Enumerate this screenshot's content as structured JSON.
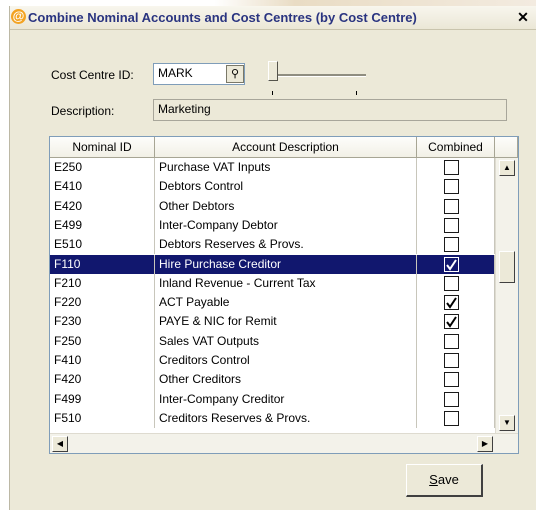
{
  "window": {
    "title": "Combine Nominal Accounts and Cost Centres (by Cost Centre)",
    "icon": "@",
    "close_label": "✕"
  },
  "form": {
    "cost_centre_label": "Cost Centre ID:",
    "cost_centre_value": "MARK",
    "lookup_icon": "magnifier-icon",
    "lookup_glyph": "⚲",
    "description_label": "Description:",
    "description_value": "Marketing"
  },
  "grid": {
    "columns": [
      "Nominal ID",
      "Account Description",
      "Combined"
    ],
    "rows": [
      {
        "id": "E250",
        "desc": "Purchase VAT Inputs",
        "combined": false,
        "selected": false
      },
      {
        "id": "E410",
        "desc": "Debtors Control",
        "combined": false,
        "selected": false
      },
      {
        "id": "E420",
        "desc": "Other Debtors",
        "combined": false,
        "selected": false
      },
      {
        "id": "E499",
        "desc": "Inter-Company Debtor",
        "combined": false,
        "selected": false
      },
      {
        "id": "E510",
        "desc": "Debtors Reserves & Provs.",
        "combined": false,
        "selected": false
      },
      {
        "id": "F110",
        "desc": "Hire Purchase Creditor",
        "combined": true,
        "selected": true
      },
      {
        "id": "F210",
        "desc": "Inland Revenue - Current Tax",
        "combined": false,
        "selected": false
      },
      {
        "id": "F220",
        "desc": "ACT Payable",
        "combined": true,
        "selected": false
      },
      {
        "id": "F230",
        "desc": "PAYE & NIC for Remit",
        "combined": true,
        "selected": false
      },
      {
        "id": "F250",
        "desc": "Sales VAT Outputs",
        "combined": false,
        "selected": false
      },
      {
        "id": "F410",
        "desc": "Creditors Control",
        "combined": false,
        "selected": false
      },
      {
        "id": "F420",
        "desc": "Other Creditors",
        "combined": false,
        "selected": false
      },
      {
        "id": "F499",
        "desc": "Inter-Company Creditor",
        "combined": false,
        "selected": false
      },
      {
        "id": "F510",
        "desc": "Creditors Reserves & Provs.",
        "combined": false,
        "selected": false
      }
    ],
    "scroll_up_glyph": "▲",
    "scroll_down_glyph": "▼",
    "scroll_left_glyph": "◀",
    "scroll_right_glyph": "▶"
  },
  "actions": {
    "save_mnemonic": "S",
    "save_rest": "ave"
  },
  "colors": {
    "selection": "#11176e",
    "title_text": "#2a3480",
    "dialog_bg": "#ece9d8"
  }
}
